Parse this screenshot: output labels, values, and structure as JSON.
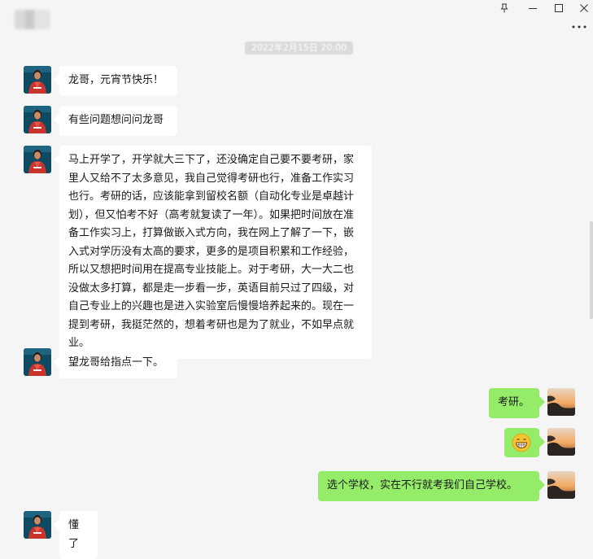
{
  "window": {
    "contact_name": "▒▒▒▒",
    "controls": {
      "pin": "pin-icon",
      "minimize": "minimize-icon",
      "maximize": "maximize-icon",
      "close": "close-icon",
      "more": "more-icon"
    }
  },
  "chat": {
    "timestamp": "2022年2月15日 20:00",
    "messages": [
      {
        "side": "in",
        "text": "龙哥，元宵节快乐！"
      },
      {
        "side": "in",
        "text": "有些问题想问问龙哥"
      },
      {
        "side": "in",
        "text": "马上开学了，开学就大三下了，还没确定自己要不要考研，家里人又给不了太多意见，我自己觉得考研也行，准备工作实习也行。考研的话，应该能拿到留校名额（自动化专业是卓越计划），但又怕考不好（高考就复读了一年）。如果把时间放在准备工作实习上，打算做嵌入式方向，我在网上了解了一下，嵌入式对学历没有太高的要求，更多的是项目积累和工作经验，所以又想把时间用在提高专业技能上。对于考研，大一大二也没做太多打算，都是走一步看一步，英语目前只过了四级，对自己专业上的兴趣也是进入实验室后慢慢培养起来的。现在一提到考研，我挺茫然的，想着考研也是为了就业，不如早点就业。"
      },
      {
        "side": "in",
        "text": "望龙哥给指点一下。"
      },
      {
        "side": "out",
        "text": "考研。"
      },
      {
        "side": "out",
        "emoji": "grin-emoji"
      },
      {
        "side": "out",
        "text": "选个学校，实在不行就考我们自己学校。"
      },
      {
        "side": "in",
        "text": "懂了"
      }
    ]
  },
  "colors": {
    "background": "#f5f5f5",
    "incoming_bubble": "#ffffff",
    "outgoing_bubble": "#95ec69",
    "text": "#191919"
  }
}
